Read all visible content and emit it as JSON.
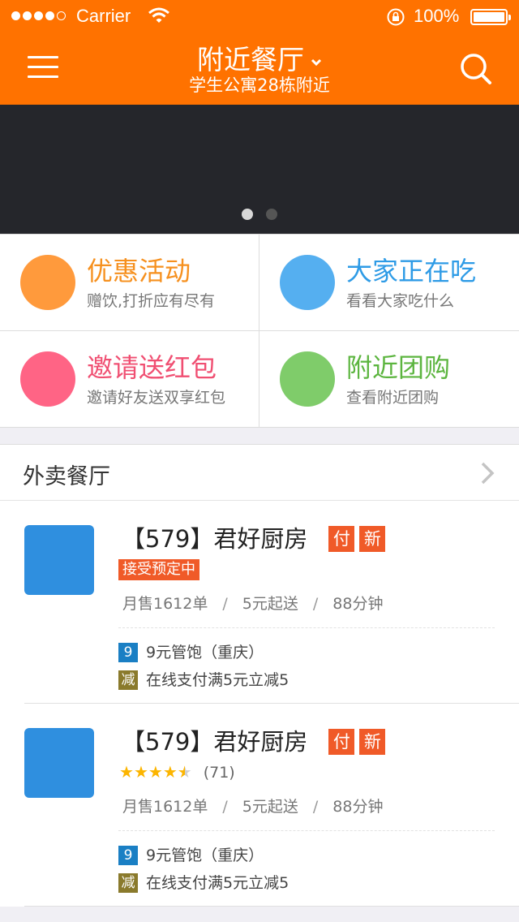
{
  "status": {
    "carrier": "Carrier",
    "battery": "100%"
  },
  "nav": {
    "title": "附近餐厅",
    "subtitle": "学生公寓28栋附近"
  },
  "banner": {
    "page_count": 2,
    "active_page": 1
  },
  "grid": [
    {
      "title": "优惠活动",
      "subtitle": "赠饮,打折应有尽有",
      "color": "#ff9a3c",
      "title_color": "#f6901e"
    },
    {
      "title": "大家正在吃",
      "subtitle": "看看大家吃什么",
      "color": "#55aff0",
      "title_color": "#2e9be6"
    },
    {
      "title": "邀请送红包",
      "subtitle": "邀请好友送双享红包",
      "color": "#ff6485",
      "title_color": "#f04f72"
    },
    {
      "title": "附近团购",
      "subtitle": "查看附近团购",
      "color": "#7fcc6a",
      "title_color": "#5cb53f"
    }
  ],
  "section": {
    "title": "外卖餐厅"
  },
  "restaurants": [
    {
      "name": "【579】君好厨房",
      "tags": [
        "付",
        "新"
      ],
      "badge": "接受预定中",
      "monthly_sales": "月售1612单",
      "min_order": "5元起送",
      "delivery_time": "88分钟",
      "sep": "/",
      "promos": [
        {
          "icon": "9",
          "icon_color": "#1a7fc4",
          "text": "9元管饱（重庆）"
        },
        {
          "icon": "减",
          "icon_color": "#8a7a2c",
          "text": "在线支付满5元立减5"
        }
      ]
    },
    {
      "name": "【579】君好厨房",
      "tags": [
        "付",
        "新"
      ],
      "rating": 4.5,
      "rating_count": "(71)",
      "monthly_sales": "月售1612单",
      "min_order": "5元起送",
      "delivery_time": "88分钟",
      "sep": "/",
      "promos": [
        {
          "icon": "9",
          "icon_color": "#1a7fc4",
          "text": "9元管饱（重庆）"
        },
        {
          "icon": "减",
          "icon_color": "#8a7a2c",
          "text": "在线支付满5元立减5"
        }
      ]
    }
  ],
  "colors": {
    "primary": "#ff7200",
    "tag": "#f05a28",
    "thumb": "#2f8fdf"
  }
}
